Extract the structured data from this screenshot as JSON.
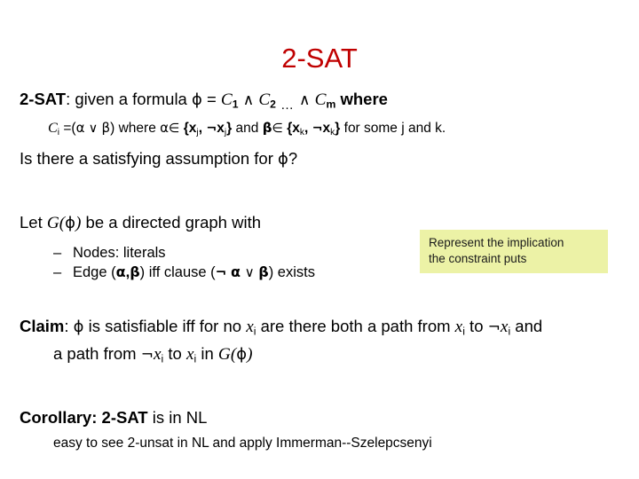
{
  "slide": {
    "title": "2-SAT",
    "title_color": "#C00000",
    "background": "#FFFFFF"
  },
  "definition": {
    "label": "2-SAT",
    "colon": ":",
    "text_given": " given a formula ",
    "phi": "ϕ",
    "equals": " = ",
    "c1": "C",
    "c1_sub": "1",
    "wedge1": "∧",
    "c2": "C",
    "c2_sub": "2",
    "ellipsis": "…",
    "wedge2": "∧",
    "cm": "C",
    "cm_sub": "m",
    "where": " where",
    "clause_line": {
      "ci": "C",
      "ci_sub": "i",
      "eq_open": " =(",
      "alpha": "α",
      "vee": "∨",
      "beta": "β",
      "close_where": ") where ",
      "alpha2": "α",
      "in1": "∈",
      "set1_open": " {",
      "xj": "x",
      "xj_sub": "j",
      "comma1": ", ",
      "neg1": "¬",
      "xj2": "x",
      "xj2_sub": "j",
      "set1_close": "}",
      "and": " and ",
      "beta2": "β",
      "in2": "∈",
      "set2_open": " {",
      "xk": "x",
      "xk_sub": "k",
      "comma2": ", ",
      "neg2": "¬",
      "xk2": "x",
      "xk2_sub": "k",
      "set2_close": "}",
      "tail": " for some j and k."
    }
  },
  "question": {
    "text_before": "Is there a satisfying assumption for ",
    "phi": "ϕ",
    "text_after": "?"
  },
  "graph": {
    "let_before": "Let ",
    "g": "G",
    "paren_open": "(",
    "phi": "ϕ",
    "paren_close": ")",
    "let_after": " be a directed graph with",
    "bullets": [
      {
        "dash": "–",
        "text": "Nodes: literals"
      },
      {
        "dash": "–",
        "edge_label": "Edge (",
        "alpha": "α",
        "comma": ",",
        "beta": "β",
        "iff": ") iff clause (",
        "neg": "¬",
        "alpha2": "α",
        "vee": "∨",
        "beta2": "β",
        "tail": ") exists"
      }
    ]
  },
  "callout": {
    "line1": "Represent the implication",
    "line2": "the constraint puts",
    "background": "#ECF2A6"
  },
  "claim": {
    "label": "Claim",
    "colon": ":",
    "t1": " ",
    "phi": "ϕ",
    "t2": " is satisfiable iff for no ",
    "x1": "x",
    "x1_sub": "i",
    "t3": " are there both a path from ",
    "x2": "x",
    "x2_sub": "i",
    "t4": " to ",
    "neg1": "¬",
    "x3": "x",
    "x3_sub": "i",
    "t5": " and",
    "line2": {
      "t1": "a path from ",
      "neg": "¬",
      "x1": "x",
      "x1_sub": "i",
      "t2": " to ",
      "x2": "x",
      "x2_sub": "i",
      "t3": " in ",
      "g": "G",
      "paren_open": "(",
      "phi": "ϕ",
      "paren_close": ")"
    }
  },
  "corollary": {
    "label": "Corollary",
    "colon": ":",
    "subject": " 2-SAT",
    "rest": " is in NL",
    "note": "easy to see 2-unsat in NL and apply Immerman--Szelepcsenyi"
  }
}
